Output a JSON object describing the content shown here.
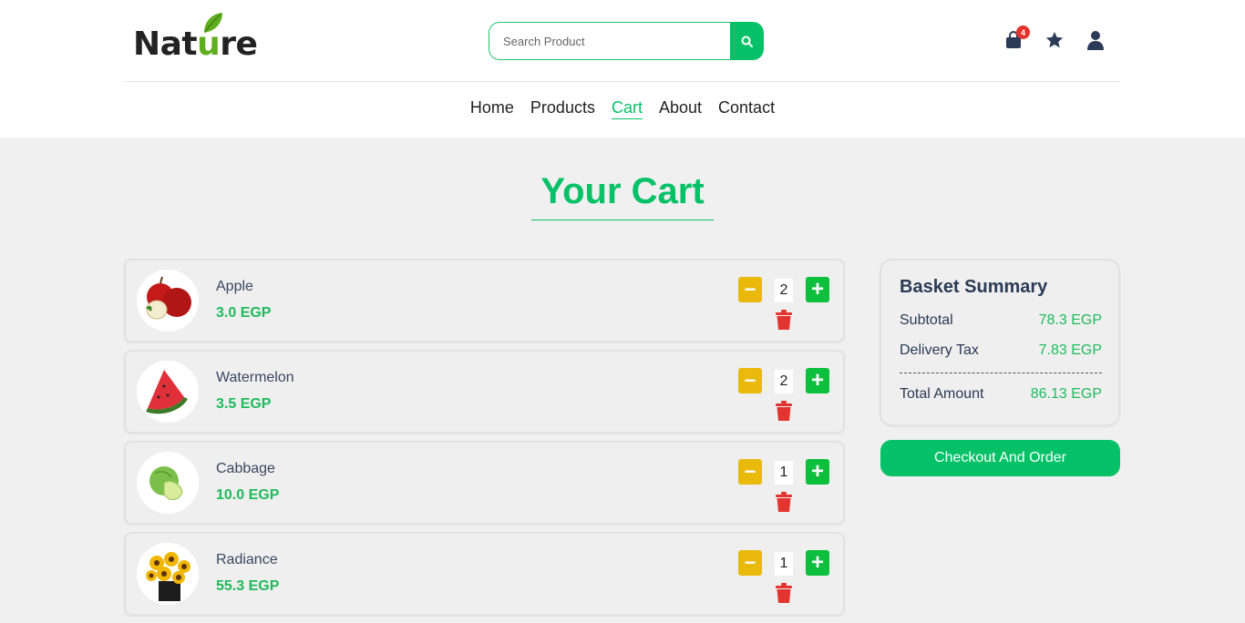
{
  "brand": {
    "logo_text": "Nature"
  },
  "search": {
    "placeholder": "Search Product"
  },
  "header_icons": {
    "cart_count": "4",
    "icons": [
      "shopping-bag-icon",
      "star-icon",
      "user-icon"
    ]
  },
  "nav": {
    "items": [
      "Home",
      "Products",
      "Cart",
      "About",
      "Contact"
    ],
    "active": "Cart"
  },
  "page": {
    "title": "Your Cart"
  },
  "cart": {
    "items": [
      {
        "name": "Apple",
        "price": "3.0 EGP",
        "qty": "2",
        "image": "apple"
      },
      {
        "name": "Watermelon",
        "price": "3.5 EGP",
        "qty": "2",
        "image": "watermelon"
      },
      {
        "name": "Cabbage",
        "price": "10.0 EGP",
        "qty": "1",
        "image": "cabbage"
      },
      {
        "name": "Radiance",
        "price": "55.3 EGP",
        "qty": "1",
        "image": "sunflower-bouquet"
      }
    ],
    "minus_label": "−",
    "plus_label": "+"
  },
  "summary": {
    "title": "Basket Summary",
    "subtotal_label": "Subtotal",
    "subtotal_value": "78.3 EGP",
    "tax_label": "Delivery Tax",
    "tax_value": "7.83 EGP",
    "total_label": "Total Amount",
    "total_value": "86.13 EGP",
    "checkout_label": "Checkout And Order"
  },
  "colors": {
    "accent": "#06c167",
    "minus": "#e9b90c",
    "plus": "#0cbf3c",
    "delete": "#e3342f",
    "text": "#2b3a55"
  }
}
